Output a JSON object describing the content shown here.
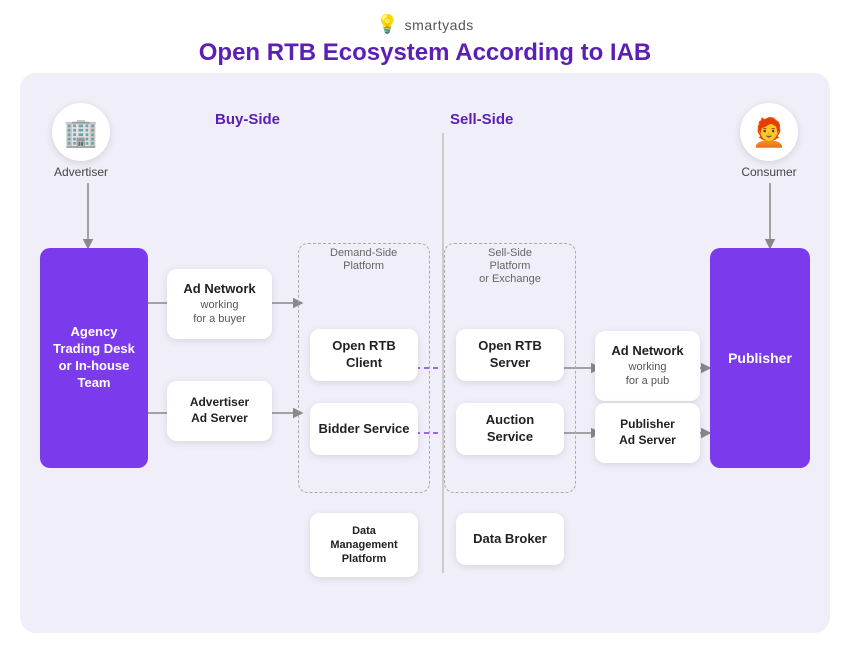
{
  "logo": {
    "icon": "💡",
    "text": "smartyads"
  },
  "title": "Open RTB Ecosystem According to IAB",
  "sections": {
    "buy_side": "Buy-Side",
    "sell_side": "Sell-Side"
  },
  "avatars": {
    "advertiser": {
      "label": "Advertiser",
      "icon": "🏢"
    },
    "consumer": {
      "label": "Consumer",
      "icon": "🧑‍🦰"
    }
  },
  "tall_boxes": {
    "agency": {
      "text": "Agency\nTrading Desk\nor In-house\nTeam"
    },
    "publisher": {
      "text": "Publisher"
    }
  },
  "white_boxes": {
    "ad_network_buy": {
      "title": "Ad Network",
      "sub": "working\nfor a buyer"
    },
    "advertiser_ad_server": {
      "title": "Advertiser\nAd Server",
      "sub": ""
    },
    "open_rtb_client": {
      "title": "Open RTB\nClient",
      "sub": ""
    },
    "bidder_service": {
      "title": "Bidder\nService",
      "sub": ""
    },
    "data_mgmt": {
      "title": "Data\nManagement\nPlatform",
      "sub": ""
    },
    "ssp_label": {
      "title": "Sell-Side\nPlatform\nor Exchange",
      "sub": ""
    },
    "open_rtb_server": {
      "title": "Open RTB\nServer",
      "sub": ""
    },
    "auction_service": {
      "title": "Auction\nService",
      "sub": ""
    },
    "data_broker": {
      "title": "Data Broker",
      "sub": ""
    },
    "ad_network_sell": {
      "title": "Ad Network",
      "sub": "working\nfor a pub"
    },
    "publisher_ad_server": {
      "title": "Publisher\nAd Server",
      "sub": ""
    }
  },
  "dashed_boxes": {
    "dsp": {
      "label": "Demand-Side\nPlatform"
    },
    "ssp": {
      "label": "Sell-Side\nPlatform\nor Exchange"
    }
  }
}
